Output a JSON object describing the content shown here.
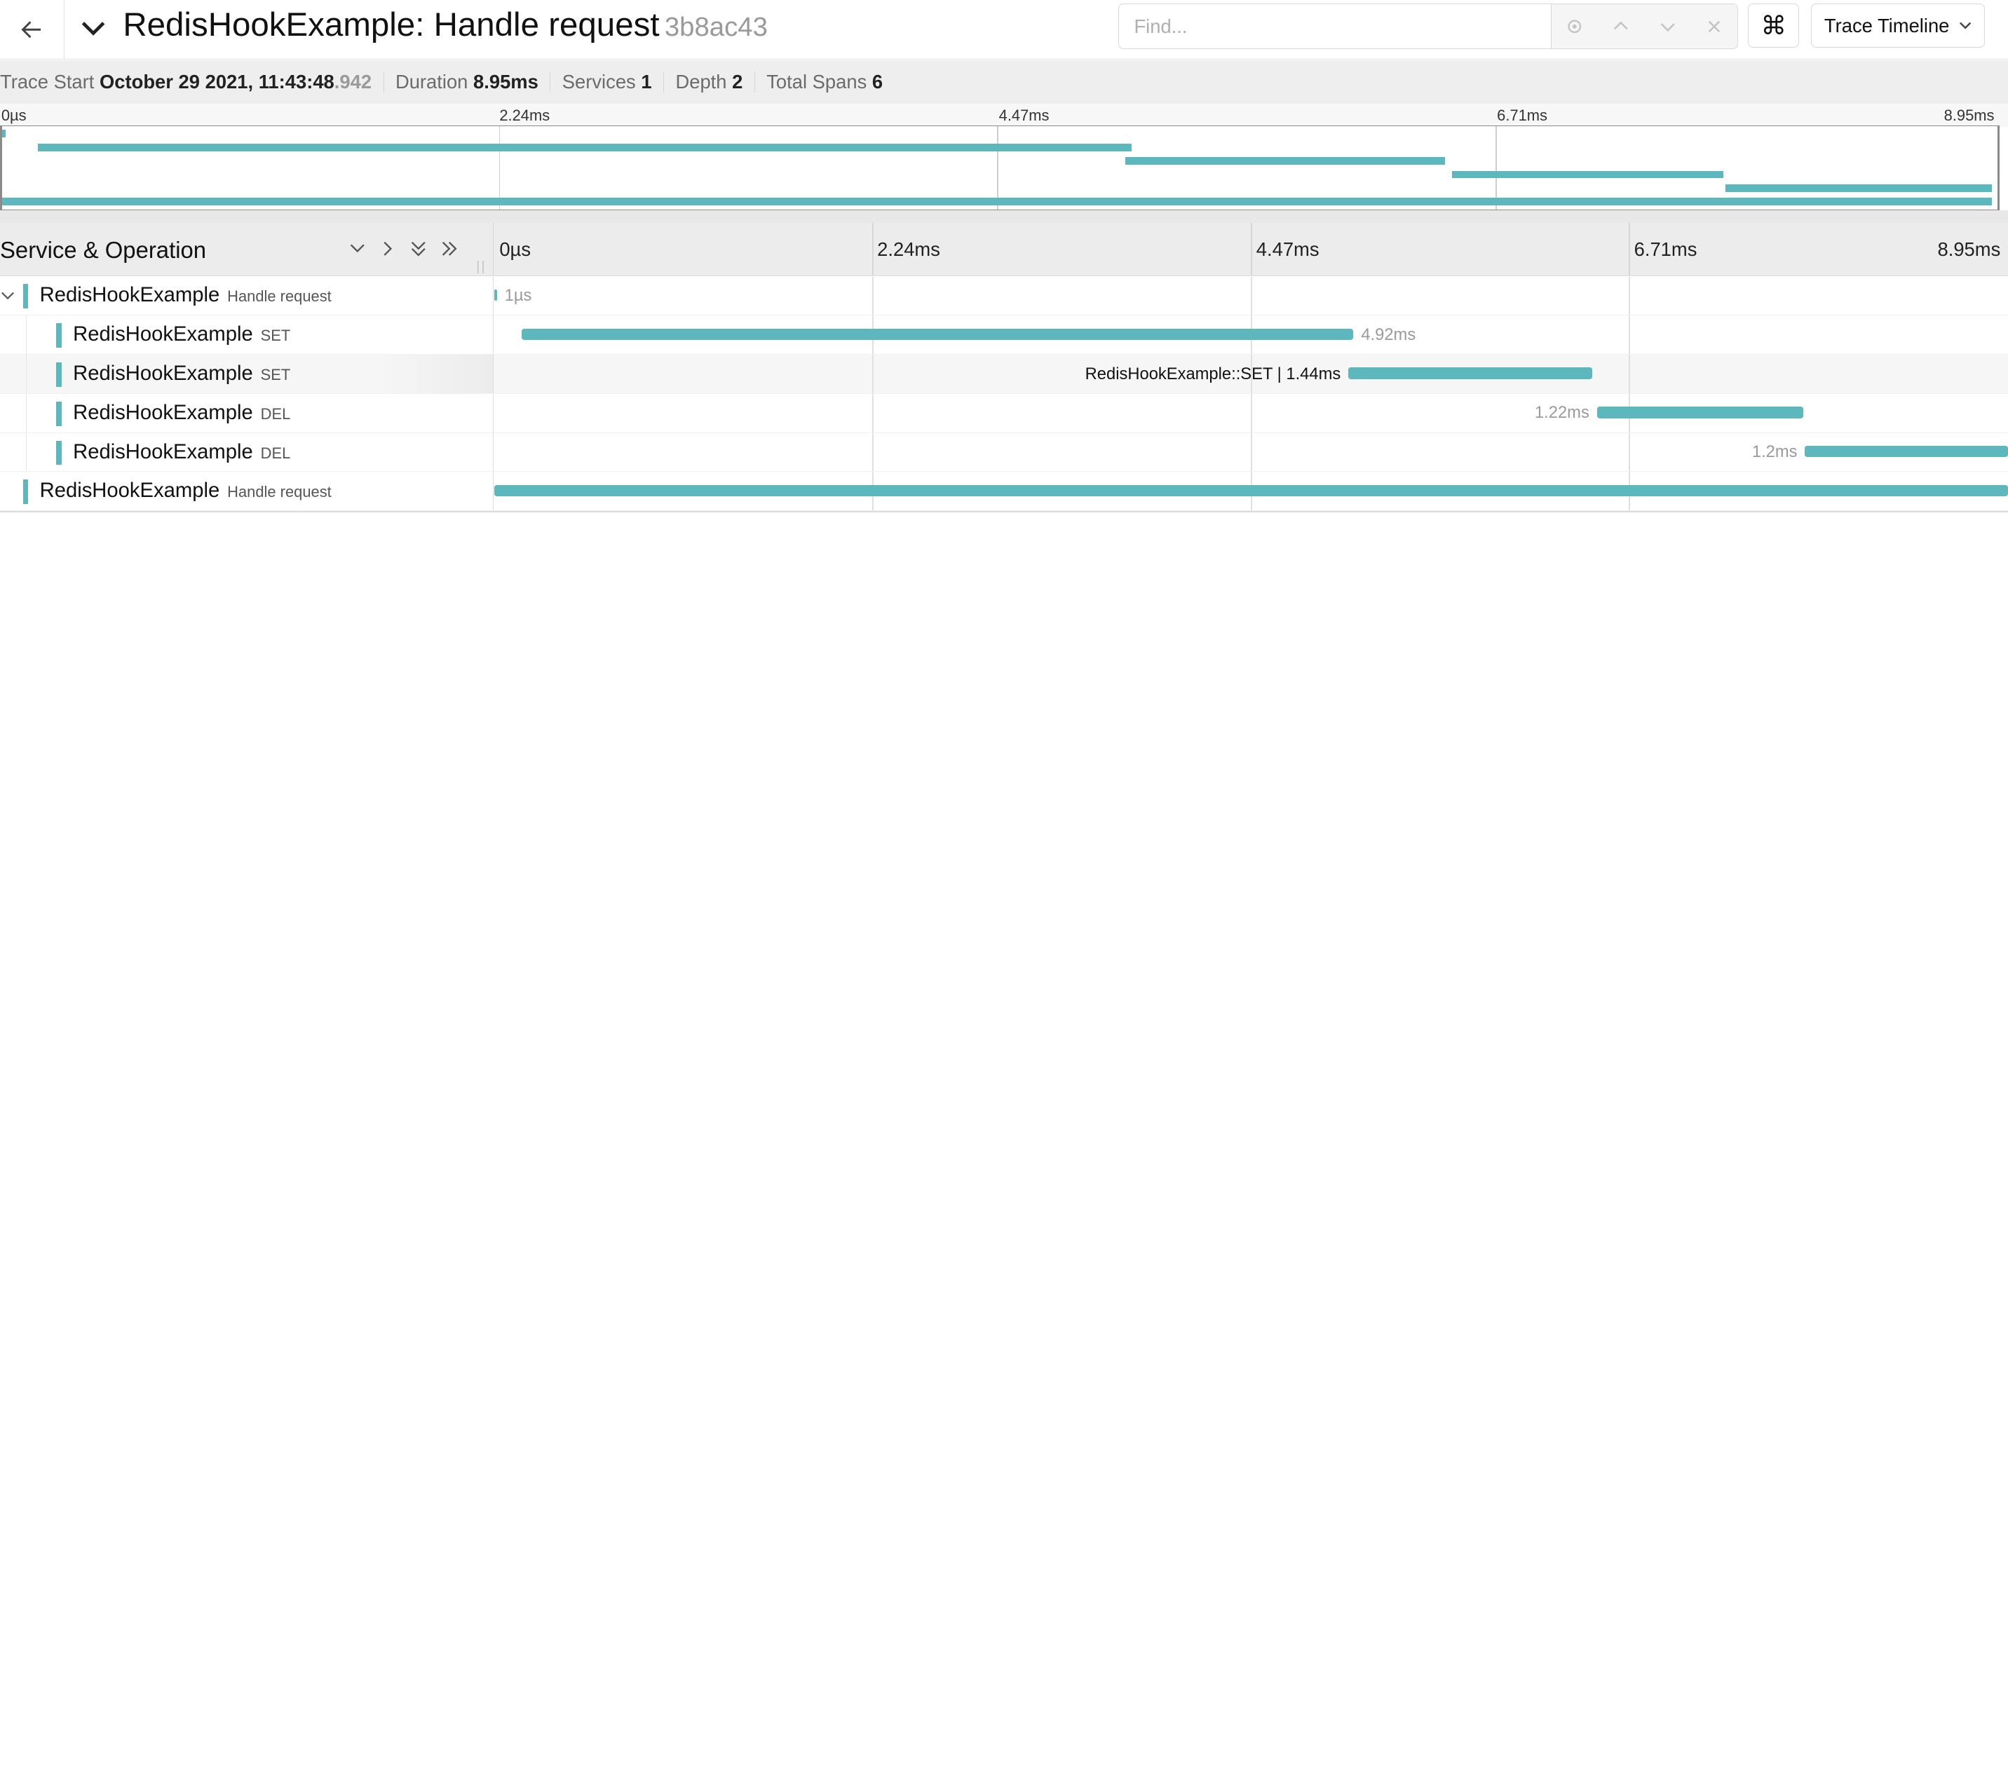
{
  "header": {
    "title": "RedisHookExample: Handle request",
    "trace_id": "3b8ac43",
    "find_placeholder": "Find...",
    "view_select_label": "Trace Timeline"
  },
  "summary": {
    "trace_start_label": "Trace Start",
    "trace_start_value": "October 29 2021, 11:43:48",
    "trace_start_ms": ".942",
    "duration_label": "Duration",
    "duration_value": "8.95ms",
    "services_label": "Services",
    "services_value": "1",
    "depth_label": "Depth",
    "depth_value": "2",
    "total_spans_label": "Total Spans",
    "total_spans_value": "6"
  },
  "ticks": [
    "0µs",
    "2.24ms",
    "4.47ms",
    "6.71ms",
    "8.95ms"
  ],
  "timeline_header": {
    "title": "Service & Operation"
  },
  "colors": {
    "span": "#5cb8bd"
  },
  "trace_duration_ms": 8.95,
  "spans": [
    {
      "service": "RedisHookExample",
      "operation": "Handle request",
      "depth": 0,
      "expandable": true,
      "start_ms": 0.0,
      "duration_ms": 0.001,
      "label": "1µs",
      "label_side": "right"
    },
    {
      "service": "RedisHookExample",
      "operation": "SET",
      "depth": 1,
      "expandable": false,
      "start_ms": 0.16,
      "duration_ms": 4.92,
      "label": "4.92ms",
      "label_side": "right"
    },
    {
      "service": "RedisHookExample",
      "operation": "SET",
      "depth": 1,
      "expandable": false,
      "start_ms": 5.05,
      "duration_ms": 1.44,
      "label": "RedisHookExample::SET | 1.44ms",
      "label_side": "left",
      "highlighted": true
    },
    {
      "service": "RedisHookExample",
      "operation": "DEL",
      "depth": 1,
      "expandable": false,
      "start_ms": 6.52,
      "duration_ms": 1.22,
      "label": "1.22ms",
      "label_side": "left"
    },
    {
      "service": "RedisHookExample",
      "operation": "DEL",
      "depth": 1,
      "expandable": false,
      "start_ms": 7.75,
      "duration_ms": 1.2,
      "label": "1.2ms",
      "label_side": "left"
    },
    {
      "service": "RedisHookExample",
      "operation": "Handle request",
      "depth": 0,
      "expandable": false,
      "start_ms": 0.0,
      "duration_ms": 8.95,
      "label": "",
      "label_side": "none"
    }
  ]
}
